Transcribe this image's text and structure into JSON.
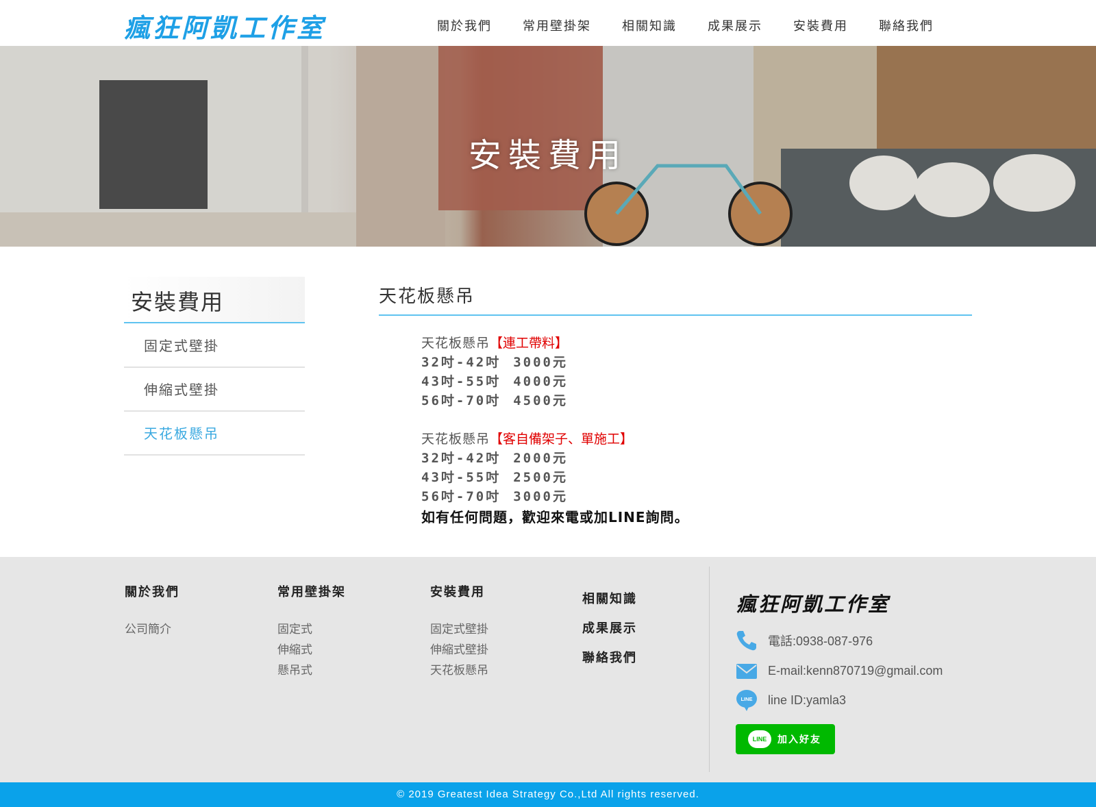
{
  "header": {
    "logo": "瘋狂阿凱工作室",
    "nav": [
      "關於我們",
      "常用壁掛架",
      "相關知識",
      "成果展示",
      "安裝費用",
      "聯絡我們"
    ]
  },
  "banner": {
    "title": "安裝費用"
  },
  "sidebar": {
    "title": "安裝費用",
    "items": [
      "固定式壁掛",
      "伸縮式壁掛",
      "天花板懸吊"
    ],
    "active_index": 2
  },
  "main": {
    "title": "天花板懸吊",
    "groups": [
      {
        "name": "天花板懸吊",
        "tag": "【連工帶料】",
        "rows": [
          {
            "size": "32吋-42吋",
            "price": "3000元"
          },
          {
            "size": "43吋-55吋",
            "price": "4000元"
          },
          {
            "size": "56吋-70吋",
            "price": "4500元"
          }
        ]
      },
      {
        "name": "天花板懸吊",
        "tag": "【客自備架子、單施工】",
        "rows": [
          {
            "size": "32吋-42吋",
            "price": "2000元"
          },
          {
            "size": "43吋-55吋",
            "price": "2500元"
          },
          {
            "size": "56吋-70吋",
            "price": "3000元"
          }
        ]
      }
    ],
    "note": "如有任何問題，歡迎來電或加LINE詢問。"
  },
  "footer": {
    "col1": {
      "title": "關於我們",
      "links": [
        "公司簡介"
      ]
    },
    "col2": {
      "title": "常用壁掛架",
      "links": [
        "固定式",
        "伸縮式",
        "懸吊式"
      ]
    },
    "col3": {
      "title": "安裝費用",
      "links": [
        "固定式壁掛",
        "伸縮式壁掛",
        "天花板懸吊"
      ]
    },
    "col4": [
      "相關知識",
      "成果展示",
      "聯絡我們"
    ],
    "logo": "瘋狂阿凱工作室",
    "phone": "電話:0938-087-976",
    "email": "E-mail:kenn870719@gmail.com",
    "line_id": "line ID:yamla3",
    "line_icon_text": "LINE",
    "line_button": "加入好友",
    "copyright": "© 2019 Greatest Idea Strategy Co.,Ltd All rights reserved.",
    "icon_color": "#48a9e6",
    "line_color": "#00b900"
  },
  "colors": {
    "accent": "#1ea0e6",
    "copyright_bar": "#0aa2ea",
    "tag_red": "#e00000"
  }
}
